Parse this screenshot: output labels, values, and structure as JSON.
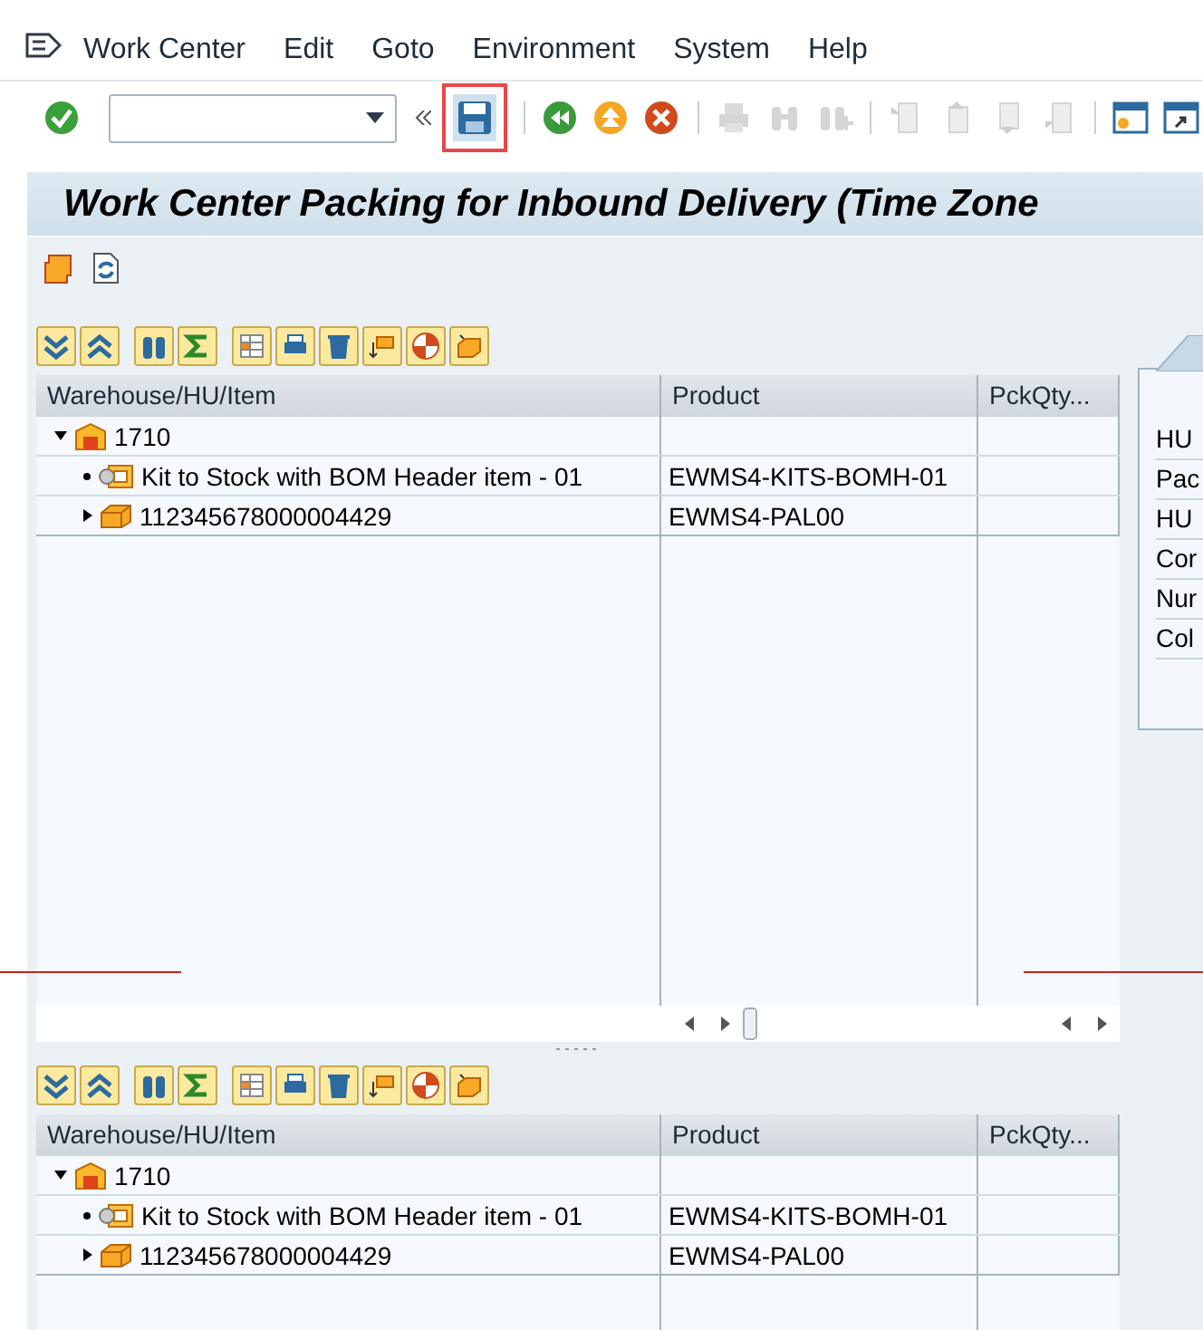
{
  "menu_bar": {
    "items": [
      "Work Center",
      "Edit",
      "Goto",
      "Environment",
      "System",
      "Help"
    ]
  },
  "toolbar": {
    "buttons": [
      {
        "kind": "save",
        "disabled": false,
        "highlighted": true
      },
      {
        "kind": "back",
        "disabled": false,
        "highlighted": false
      },
      {
        "kind": "exit",
        "disabled": false,
        "highlighted": false
      },
      {
        "kind": "cancel",
        "disabled": false,
        "highlighted": false
      },
      {
        "kind": "print",
        "disabled": true,
        "highlighted": false
      },
      {
        "kind": "find",
        "disabled": true,
        "highlighted": false
      },
      {
        "kind": "find_next",
        "disabled": true,
        "highlighted": false
      },
      {
        "kind": "first_page",
        "disabled": true,
        "highlighted": false
      },
      {
        "kind": "prev_page",
        "disabled": true,
        "highlighted": false
      },
      {
        "kind": "next_page",
        "disabled": true,
        "highlighted": false
      },
      {
        "kind": "last_page",
        "disabled": true,
        "highlighted": false
      },
      {
        "kind": "new_session",
        "disabled": false,
        "highlighted": false
      },
      {
        "kind": "shortcut",
        "disabled": false,
        "highlighted": false
      }
    ]
  },
  "title": "Work Center Packing for Inbound Delivery (Time Zone",
  "trees": [
    {
      "columns": [
        "Warehouse/HU/Item",
        "Product",
        "PckQty..."
      ],
      "rows": [
        {
          "kind": "warehouse",
          "label": "1710",
          "expanded": true,
          "children": [
            {
              "kind": "item",
              "label": "Kit to Stock with BOM Header item - 01",
              "product": "EWMS4-KITS-BOMH-01"
            },
            {
              "kind": "hu",
              "label": "112345678000004429",
              "product": "EWMS4-PAL00",
              "expanded": false
            }
          ]
        }
      ]
    },
    {
      "columns": [
        "Warehouse/HU/Item",
        "Product",
        "PckQty..."
      ],
      "rows": [
        {
          "kind": "warehouse",
          "label": "1710",
          "expanded": true,
          "children": [
            {
              "kind": "item",
              "label": "Kit to Stock with BOM Header item - 01",
              "product": "EWMS4-KITS-BOMH-01"
            },
            {
              "kind": "hu",
              "label": "112345678000004429",
              "product": "EWMS4-PAL00",
              "expanded": false
            }
          ]
        }
      ]
    }
  ],
  "side_panel": {
    "labels": [
      "HU",
      "Pac",
      "HU",
      "Cor",
      "Nur",
      "Col"
    ]
  }
}
